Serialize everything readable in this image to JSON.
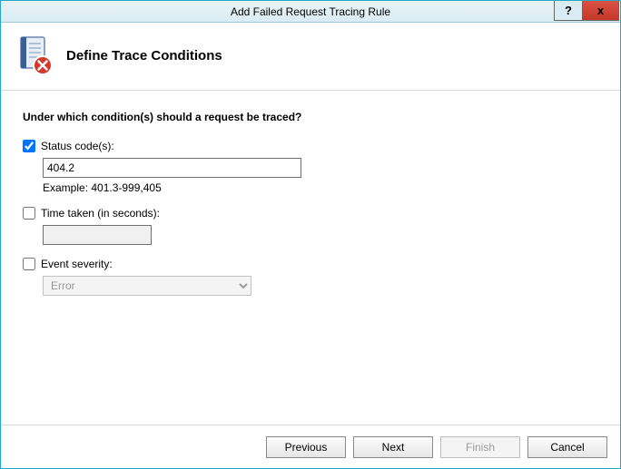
{
  "titlebar": {
    "title": "Add Failed Request Tracing Rule",
    "help_label": "?",
    "close_label": "x"
  },
  "header": {
    "heading": "Define Trace Conditions"
  },
  "content": {
    "question": "Under which condition(s) should a request be traced?",
    "status_codes": {
      "label": "Status code(s):",
      "checked": true,
      "value": "404.2",
      "example": "Example: 401.3-999,405"
    },
    "time_taken": {
      "label": "Time taken (in seconds):",
      "checked": false,
      "value": ""
    },
    "event_severity": {
      "label": "Event severity:",
      "checked": false,
      "selected": "Error"
    }
  },
  "footer": {
    "previous": "Previous",
    "next": "Next",
    "finish": "Finish",
    "cancel": "Cancel"
  }
}
